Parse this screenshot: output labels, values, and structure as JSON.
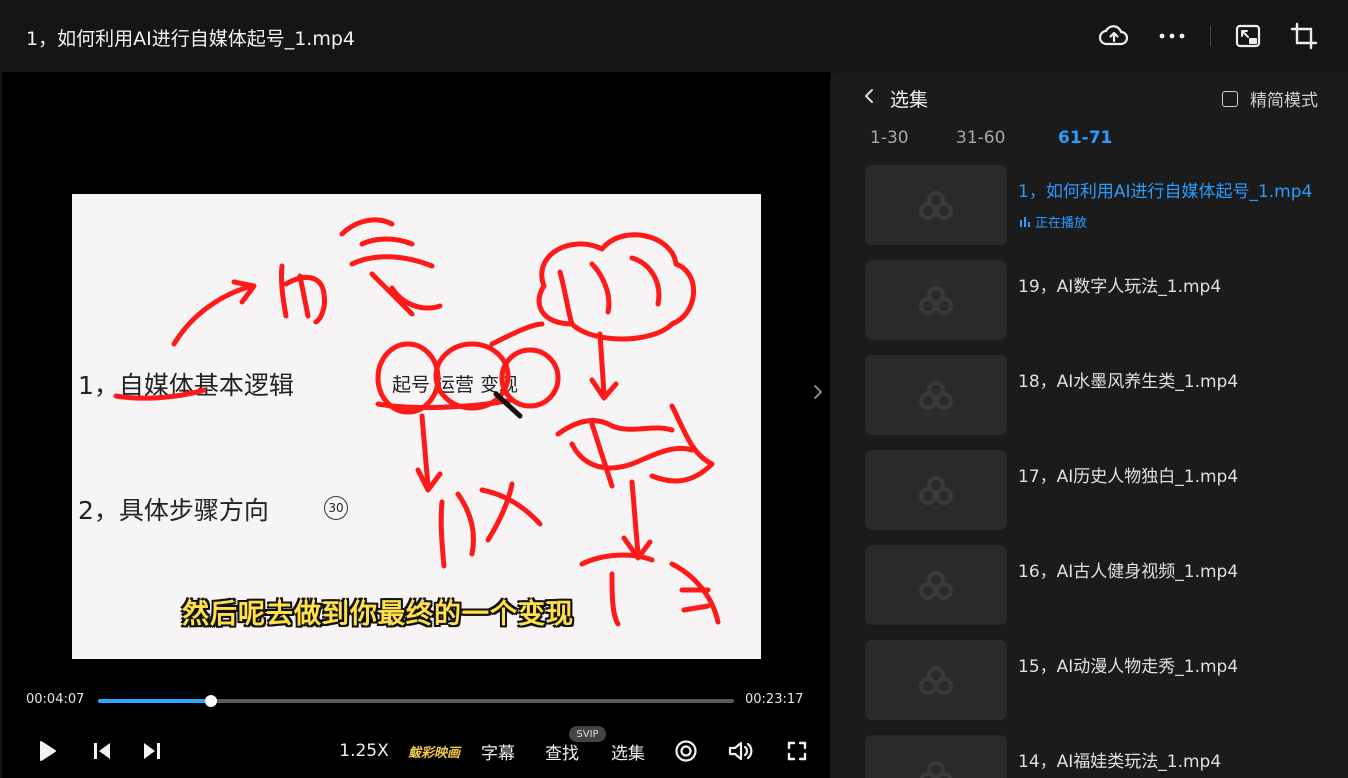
{
  "header": {
    "title": "1，如何利用AI进行自媒体起号_1.mp4",
    "icons": [
      "cloud-upload-icon",
      "more-icon",
      "picture-in-picture-icon",
      "crop-window-icon"
    ]
  },
  "video": {
    "slide_line1": "1，自媒体基本逻辑",
    "slide_bubbles": "起号 运营 变现",
    "slide_line2": "2，具体步骤方向",
    "circle_number": "30",
    "subtitle": "然后呢去做到你最终的一个变现"
  },
  "progress": {
    "current_time": "00:04:07",
    "total_time": "00:23:17",
    "played_fraction": 0.177
  },
  "controls": {
    "speed": "1.25X",
    "brand": "鲅彩映画",
    "subtitles": "字幕",
    "search": "查找",
    "search_badge": "SVIP",
    "episodes": "选集"
  },
  "panel": {
    "title": "选集",
    "compact_mode": "精简模式",
    "ranges": [
      "1-30",
      "31-60",
      "61-71"
    ],
    "active_range": "61-71",
    "now_playing": "正在播放",
    "episodes": [
      {
        "title": "1，如何利用AI进行自媒体起号_1.mp4",
        "current": true
      },
      {
        "title": "19，AI数字人玩法_1.mp4"
      },
      {
        "title": "18，AI水墨风养生类_1.mp4"
      },
      {
        "title": "17，AI历史人物独白_1.mp4"
      },
      {
        "title": "16，AI古人健身视频_1.mp4"
      },
      {
        "title": "15，AI动漫人物走秀_1.mp4"
      },
      {
        "title": "14，AI福娃类玩法_1.mp4"
      }
    ]
  },
  "colors": {
    "accent": "#2b9bff",
    "subtitle": "#ffe04a",
    "annotation": "#ff1a1a"
  }
}
